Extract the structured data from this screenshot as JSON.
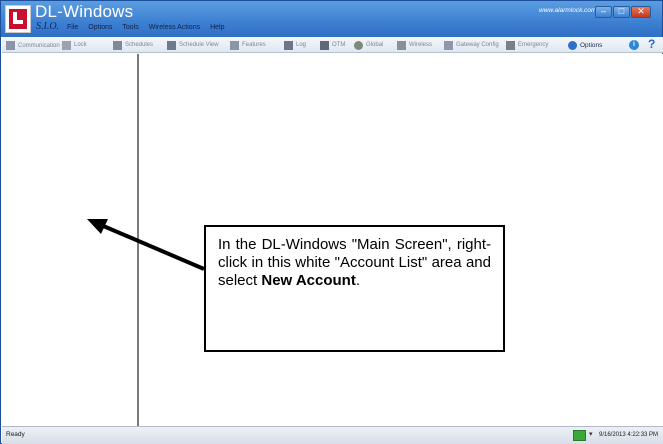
{
  "window": {
    "title": "DL-Windows",
    "subtitle": "S.I.O.",
    "site_url": "www.alarmlock.com",
    "menu": [
      "File",
      "Options",
      "Tools",
      "Wireless Actions",
      "Help"
    ]
  },
  "toolbar": {
    "items": [
      {
        "label": "Communication ▾",
        "icon": "communication-icon",
        "enabled": false
      },
      {
        "label": "Lock",
        "icon": "lock-icon",
        "enabled": false
      },
      {
        "label": "Schedules",
        "icon": "calendar-icon",
        "enabled": false
      },
      {
        "label": "Schedule View",
        "icon": "calendar-view-icon",
        "enabled": false
      },
      {
        "label": "Features",
        "icon": "features-icon",
        "enabled": false
      },
      {
        "label": "Log",
        "icon": "log-icon",
        "enabled": false
      },
      {
        "label": "OTM",
        "icon": "otm-icon",
        "enabled": false
      },
      {
        "label": "Global",
        "icon": "globe-icon",
        "enabled": false
      },
      {
        "label": "Wireless",
        "icon": "wireless-icon",
        "enabled": false
      },
      {
        "label": "Gateway Config",
        "icon": "gateway-icon",
        "enabled": false
      },
      {
        "label": "Emergency",
        "icon": "emergency-icon",
        "enabled": false
      },
      {
        "label": "Options",
        "icon": "gear-icon",
        "enabled": true
      }
    ],
    "help_info": "i",
    "help_question": "?"
  },
  "callout": {
    "text_before": "In the DL-Windows \"Main Screen\", right-click in this white \"Account List\" area and select ",
    "bold": "New Account",
    "text_after": "."
  },
  "status": {
    "text": "Ready",
    "datetime": "9/16/2013 4:22:33 PM"
  },
  "colors": {
    "titlebar": "#3f82d3",
    "close": "#c23a1e",
    "logo": "#c8102e"
  }
}
